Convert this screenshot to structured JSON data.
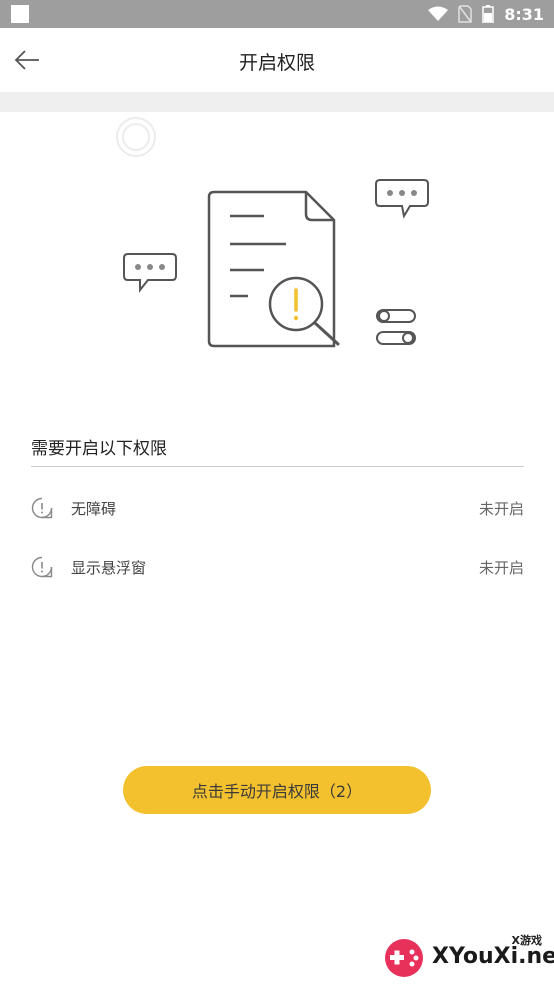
{
  "status_bar": {
    "time": "8:31"
  },
  "header": {
    "title": "开启权限"
  },
  "section": {
    "title": "需要开启以下权限"
  },
  "permissions": [
    {
      "name": "无障碍",
      "status": "未开启"
    },
    {
      "name": "显示悬浮窗",
      "status": "未开启"
    }
  ],
  "cta": {
    "label": "点击手动开启权限（2）"
  },
  "watermark": {
    "small": "X游戏",
    "big": "XYouXi.net"
  },
  "colors": {
    "accent": "#f4c12e",
    "status_bar": "#9e9e9e",
    "band": "#efefef"
  }
}
